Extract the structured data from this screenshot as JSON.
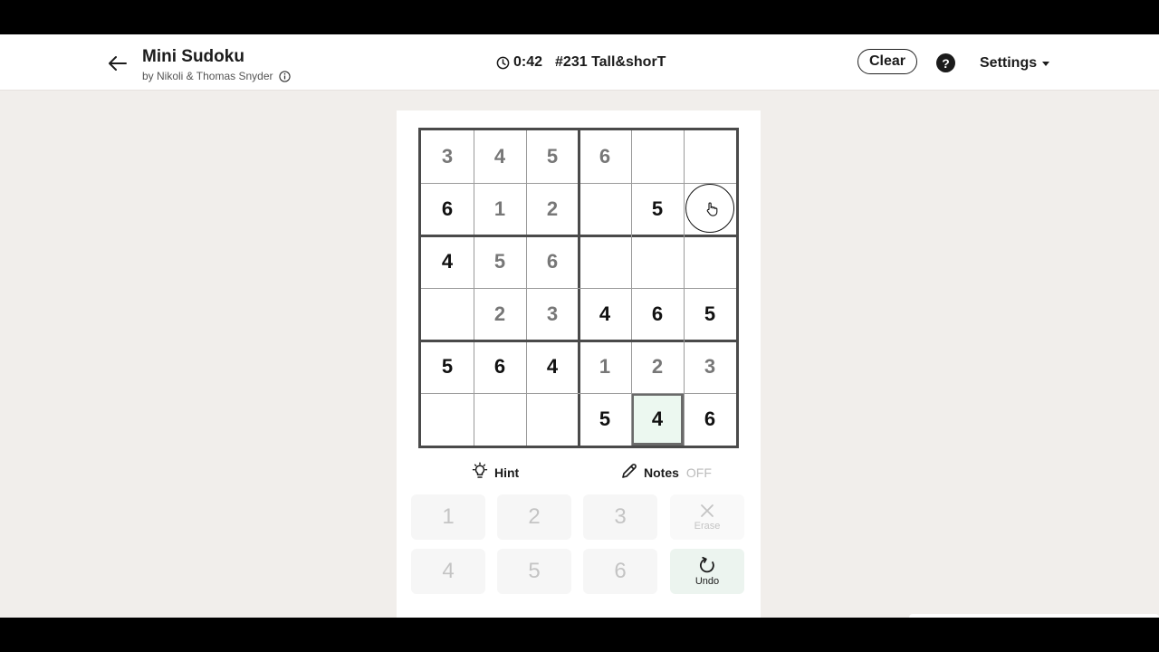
{
  "header": {
    "title": "Mini Sudoku",
    "byline": "by Nikoli & Thomas Snyder",
    "timer": "0:42",
    "puzzle": "#231 Tall&shorT",
    "clear_label": "Clear",
    "help_label": "?",
    "settings_label": "Settings"
  },
  "grid": {
    "rows": [
      [
        {
          "v": "3",
          "t": "entered"
        },
        {
          "v": "4",
          "t": "entered"
        },
        {
          "v": "5",
          "t": "entered"
        },
        {
          "v": "6",
          "t": "entered"
        },
        {
          "v": "",
          "t": "empty"
        },
        {
          "v": "",
          "t": "empty"
        }
      ],
      [
        {
          "v": "6",
          "t": "given"
        },
        {
          "v": "1",
          "t": "entered"
        },
        {
          "v": "2",
          "t": "entered"
        },
        {
          "v": "",
          "t": "empty"
        },
        {
          "v": "5",
          "t": "given"
        },
        {
          "v": "",
          "t": "empty"
        }
      ],
      [
        {
          "v": "4",
          "t": "given"
        },
        {
          "v": "5",
          "t": "entered"
        },
        {
          "v": "6",
          "t": "entered"
        },
        {
          "v": "",
          "t": "empty"
        },
        {
          "v": "",
          "t": "empty"
        },
        {
          "v": "",
          "t": "empty"
        }
      ],
      [
        {
          "v": "",
          "t": "empty"
        },
        {
          "v": "2",
          "t": "entered"
        },
        {
          "v": "3",
          "t": "entered"
        },
        {
          "v": "4",
          "t": "given"
        },
        {
          "v": "6",
          "t": "given"
        },
        {
          "v": "5",
          "t": "given"
        }
      ],
      [
        {
          "v": "5",
          "t": "given"
        },
        {
          "v": "6",
          "t": "given"
        },
        {
          "v": "4",
          "t": "given"
        },
        {
          "v": "1",
          "t": "entered"
        },
        {
          "v": "2",
          "t": "entered"
        },
        {
          "v": "3",
          "t": "entered"
        }
      ],
      [
        {
          "v": "",
          "t": "empty"
        },
        {
          "v": "",
          "t": "empty"
        },
        {
          "v": "",
          "t": "empty"
        },
        {
          "v": "5",
          "t": "given"
        },
        {
          "v": "4",
          "t": "selected"
        },
        {
          "v": "6",
          "t": "given"
        }
      ]
    ]
  },
  "controls": {
    "hint_label": "Hint",
    "notes_label": "Notes",
    "notes_state": "OFF"
  },
  "keypad": {
    "digits": [
      "1",
      "2",
      "3",
      "4",
      "5",
      "6"
    ],
    "erase_label": "Erase",
    "undo_label": "Undo"
  },
  "colors": {
    "selected_cell": "#ecf8f0",
    "background": "#f1eeeb",
    "given_digit": "#111111",
    "entered_digit": "#777777"
  }
}
